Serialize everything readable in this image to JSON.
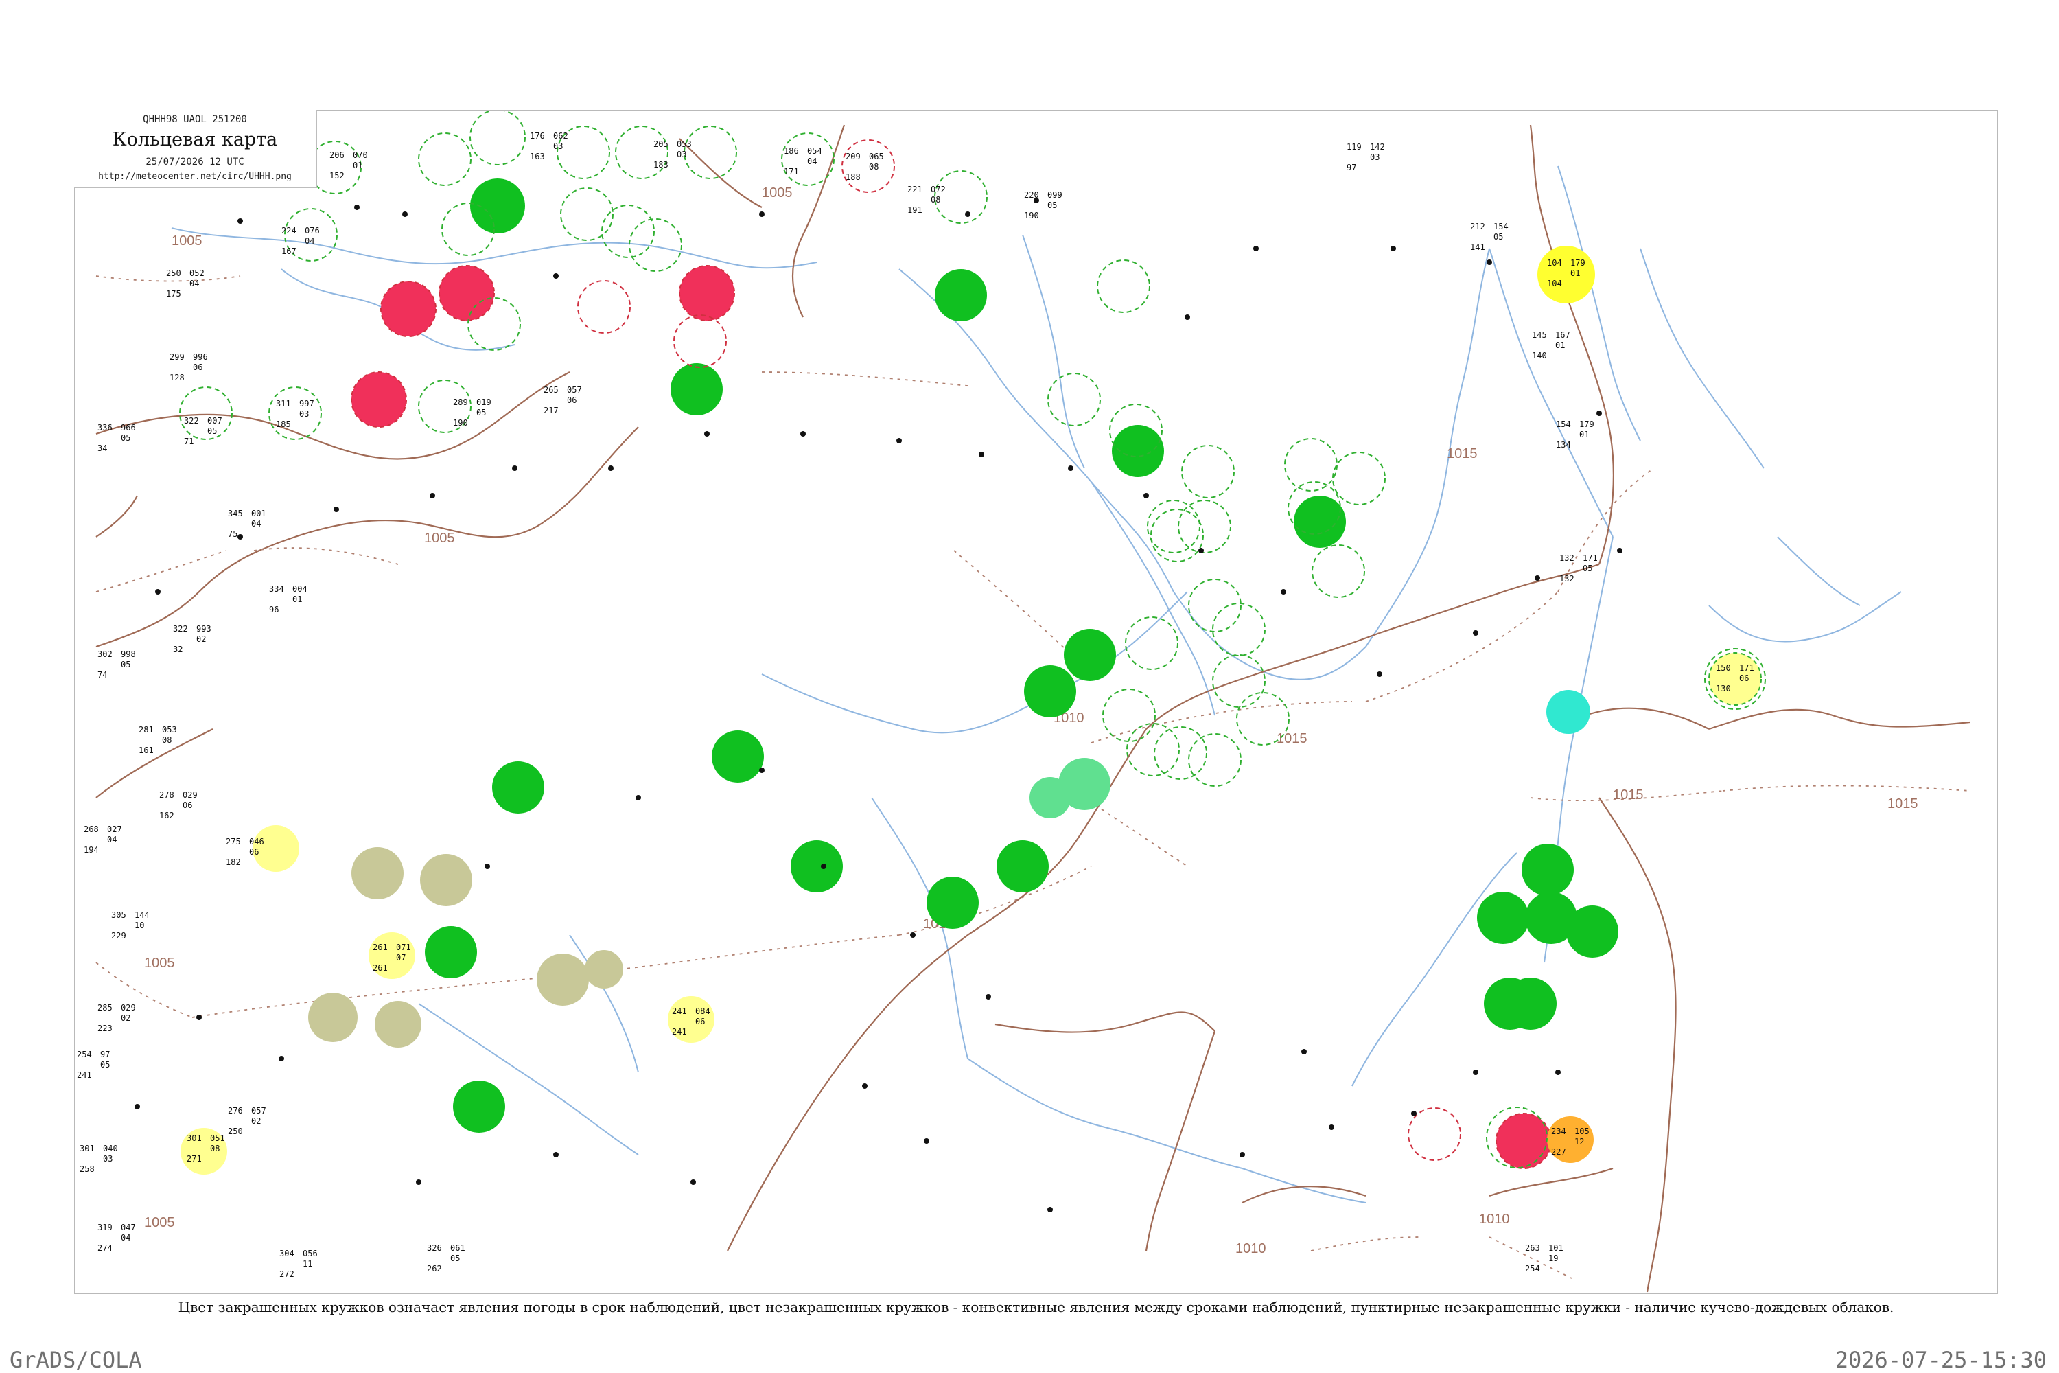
{
  "header": {
    "code_line": "QHHH98  UAOL  251200",
    "title": "Кольцевая карта",
    "date_line": "25/07/2026 12 UTC",
    "url": "http://meteocenter.net/circ/UHHH.png"
  },
  "legend_caption": "Цвет закрашенных кружков означает явления погоды в срок наблюдений, цвет незакрашенных кружков - конвективные явления между сроками наблюдений, пунктирные незакрашенные кружки - наличие кучево-дождевых облаков.",
  "footer": {
    "left": "GrADS/COLA",
    "right": "2026-07-25-15:30"
  },
  "colors": {
    "isobar": "#b08070",
    "river": "#8fb6e0",
    "rain_green": "#10c020",
    "thunder_red": "#f0305a",
    "fog_yellow": "#ffff30",
    "haze_khaki": "#c8c898",
    "drizzle_lightgreen": "#60e090",
    "shower_cyan": "#30e8d0",
    "mist_paleyellow": "#ffff90",
    "dust_orange": "#ffb030",
    "ring_green": "#30b030",
    "ring_red": "#d03040",
    "frame": "#b9b9b9"
  },
  "isobar_labels": [
    {
      "text": "1005"
    },
    {
      "text": "1005"
    },
    {
      "text": "1005"
    },
    {
      "text": "1005"
    },
    {
      "text": "1005"
    },
    {
      "text": "1010"
    },
    {
      "text": "1010"
    },
    {
      "text": "1010"
    },
    {
      "text": "1010"
    },
    {
      "text": "1015"
    },
    {
      "text": "1015"
    },
    {
      "text": "1015"
    },
    {
      "text": "1015"
    }
  ],
  "stations": [
    {
      "temp": "206",
      "dew": "152",
      "press": "070",
      "tend": "01"
    },
    {
      "temp": "176",
      "dew": "163",
      "press": "062",
      "tend": "03"
    },
    {
      "temp": "205",
      "dew": "183",
      "press": "053",
      "tend": "03"
    },
    {
      "temp": "186",
      "dew": "171",
      "press": "054",
      "tend": "04"
    },
    {
      "temp": "209",
      "dew": "188",
      "press": "065",
      "tend": "08"
    },
    {
      "temp": "221",
      "dew": "191",
      "press": "072",
      "tend": "08"
    },
    {
      "temp": "220",
      "dew": "190",
      "press": "099",
      "tend": "05"
    },
    {
      "temp": "224",
      "dew": "167",
      "press": "076",
      "tend": "04"
    },
    {
      "temp": "250",
      "dew": "175",
      "press": "052",
      "tend": "04"
    },
    {
      "temp": "299",
      "dew": "128",
      "press": "996",
      "tend": "06"
    },
    {
      "temp": "336",
      "dew": "34",
      "press": "966",
      "tend": "05"
    },
    {
      "temp": "322",
      "dew": "71",
      "press": "007",
      "tend": "05"
    },
    {
      "temp": "311",
      "dew": "185",
      "press": "997",
      "tend": "03"
    },
    {
      "temp": "289",
      "dew": "190",
      "press": "019",
      "tend": "05"
    },
    {
      "temp": "265",
      "dew": "217",
      "press": "057",
      "tend": "06"
    },
    {
      "temp": "345",
      "dew": "75",
      "press": "001",
      "tend": "04"
    },
    {
      "temp": "334",
      "dew": "96",
      "press": "004",
      "tend": "01"
    },
    {
      "temp": "322",
      "dew": "32",
      "press": "993",
      "tend": "02"
    },
    {
      "temp": "302",
      "dew": "74",
      "press": "998",
      "tend": "05"
    },
    {
      "temp": "281",
      "dew": "161",
      "press": "053",
      "tend": "08"
    },
    {
      "temp": "278",
      "dew": "162",
      "press": "029",
      "tend": "06"
    },
    {
      "temp": "268",
      "dew": "194",
      "press": "027",
      "tend": "04"
    },
    {
      "temp": "275",
      "dew": "182",
      "press": "046",
      "tend": "06"
    },
    {
      "temp": "305",
      "dew": "229",
      "press": "144",
      "tend": "10"
    },
    {
      "temp": "285",
      "dew": "223",
      "press": "029",
      "tend": "02"
    },
    {
      "temp": "254",
      "dew": "241",
      "press": "97",
      "tend": "05"
    },
    {
      "temp": "301",
      "dew": "258",
      "press": "040",
      "tend": "03"
    },
    {
      "temp": "319",
      "dew": "274",
      "press": "047",
      "tend": "04"
    },
    {
      "temp": "304",
      "dew": "272",
      "press": "056",
      "tend": "11"
    },
    {
      "temp": "326",
      "dew": "262",
      "press": "061",
      "tend": "05"
    },
    {
      "temp": "276",
      "dew": "250",
      "press": "057",
      "tend": "02"
    },
    {
      "temp": "301",
      "dew": "271",
      "press": "051",
      "tend": "08"
    },
    {
      "temp": "104",
      "dew": "104",
      "press": "179",
      "tend": "01"
    },
    {
      "temp": "150",
      "dew": "130",
      "press": "171",
      "tend": "06"
    },
    {
      "temp": "263",
      "dew": "254",
      "press": "101",
      "tend": "19"
    },
    {
      "temp": "119",
      "dew": "97",
      "press": "142",
      "tend": "03"
    },
    {
      "temp": "212",
      "dew": "141",
      "press": "154",
      "tend": "05"
    },
    {
      "temp": "145",
      "dew": "140",
      "press": "167",
      "tend": "01"
    },
    {
      "temp": "154",
      "dew": "134",
      "press": "179",
      "tend": "01"
    },
    {
      "temp": "132",
      "dew": "132",
      "press": "171",
      "tend": "05"
    },
    {
      "temp": "234",
      "dew": "227",
      "press": "105",
      "tend": "12"
    },
    {
      "temp": "241",
      "dew": "241",
      "press": "084",
      "tend": "06"
    },
    {
      "temp": "261",
      "dew": "261",
      "press": "071",
      "tend": "07"
    }
  ]
}
